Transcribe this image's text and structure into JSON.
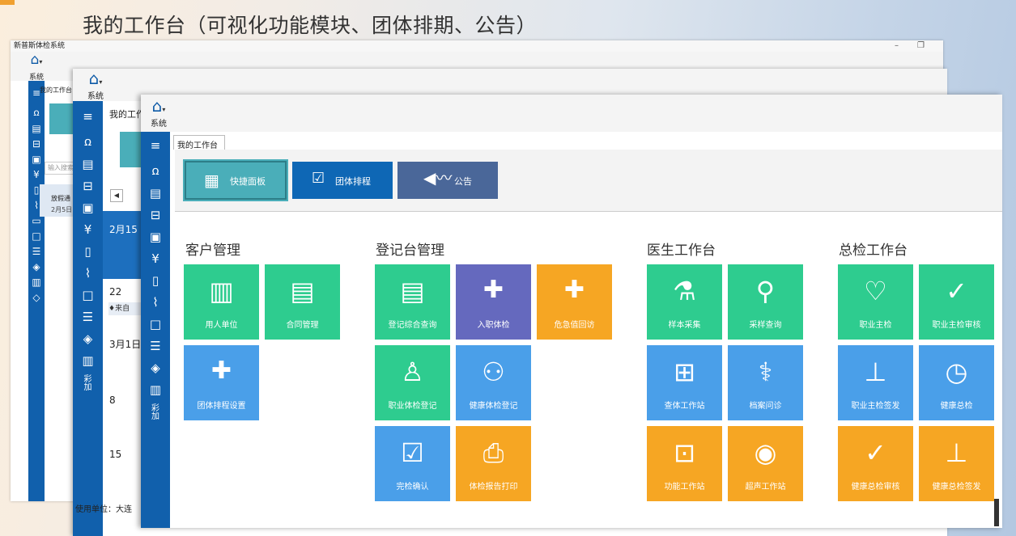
{
  "slide": {
    "title": "我的工作台（可视化功能模块、团体排期、公告）"
  },
  "window": {
    "title": "新普斯体检系统",
    "minimize": "–",
    "restore": "❐"
  },
  "ribbon": {
    "system_label": "系统"
  },
  "win1": {
    "tab": "我的工作台",
    "search_placeholder": "输入搜索",
    "notice_title": "放假通",
    "notice_date": "2月5日",
    "tab_width_hint": ""
  },
  "win2": {
    "tab": "我的工作台",
    "date1": "2月15",
    "day22": "22",
    "event": "♦来自",
    "date2": "3月1日",
    "day8": "8",
    "day15": "15",
    "footer": "使用单位：大连"
  },
  "win3": {
    "tab": "我的工作台",
    "top_buttons": {
      "quick": "快捷面板",
      "schedule": "团体排程",
      "notice": "公告"
    },
    "sections": {
      "customer": "客户管理",
      "register": "登记台管理",
      "doctor": "医生工作台",
      "chief": "总检工作台"
    },
    "tiles": {
      "employer": "用人单位",
      "contract": "合同管理",
      "group_schedule": "团体排程设置",
      "reg_query": "登记综合查询",
      "entry_exam": "入职体检",
      "critical": "危急值回访",
      "occ_reg": "职业体检登记",
      "health_reg": "健康体检登记",
      "complete": "完检确认",
      "report_print": "体检报告打印",
      "sample": "样本采集",
      "sample_query": "采样查询",
      "exam_station": "查体工作站",
      "archive": "档案问诊",
      "func_station": "功能工作站",
      "ultrasound": "超声工作站",
      "occ_main": "职业主检",
      "occ_review": "职业主检审核",
      "occ_sign": "职业主检签发",
      "health_main": "健康总检",
      "health_review": "健康总检审核",
      "health_sign": "健康总检签发"
    }
  },
  "sidebar": {
    "vertical_text": "彩\n加"
  },
  "colors": {
    "sidebar": "#1160ac",
    "green": "#2ecc8f",
    "purple": "#6569be",
    "orange": "#f6a623",
    "blue": "#4a9fe9",
    "teal": "#4aaeb9",
    "navy": "#0e67b5",
    "slate": "#4a6799"
  }
}
